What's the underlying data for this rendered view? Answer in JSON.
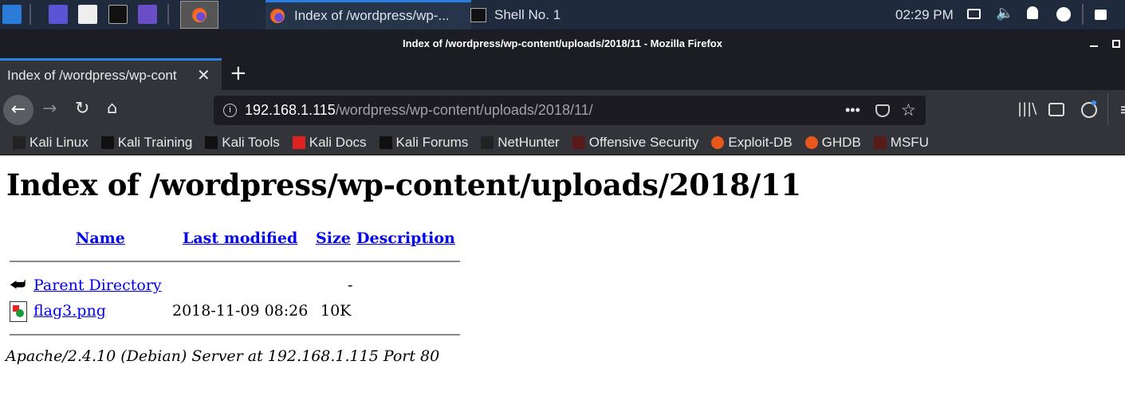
{
  "taskbar": {
    "tasks": [
      {
        "label": "Index of /wordpress/wp-..."
      },
      {
        "label": "Shell No. 1"
      }
    ],
    "clock": "02:29 PM"
  },
  "window": {
    "title": "Index of /wordpress/wp-content/uploads/2018/11 - Mozilla Firefox"
  },
  "tabs": [
    {
      "label": "Index of /wordpress/wp-cont"
    }
  ],
  "url": {
    "host": "192.168.1.115",
    "path": "/wordpress/wp-content/uploads/2018/11/"
  },
  "bookmarks": [
    "Kali Linux",
    "Kali Training",
    "Kali Tools",
    "Kali Docs",
    "Kali Forums",
    "NetHunter",
    "Offensive Security",
    "Exploit-DB",
    "GHDB",
    "MSFU"
  ],
  "page": {
    "title": "Index of /wordpress/wp-content/uploads/2018/11",
    "headers": {
      "name": "Name",
      "modified": "Last modified",
      "size": "Size",
      "description": "Description"
    },
    "rows": [
      {
        "name": "Parent Directory",
        "modified": "",
        "size": "-"
      },
      {
        "name": "flag3.png",
        "modified": "2018-11-09 08:26",
        "size": "10K"
      }
    ],
    "footer": "Apache/2.4.10 (Debian) Server at 192.168.1.115 Port 80"
  }
}
